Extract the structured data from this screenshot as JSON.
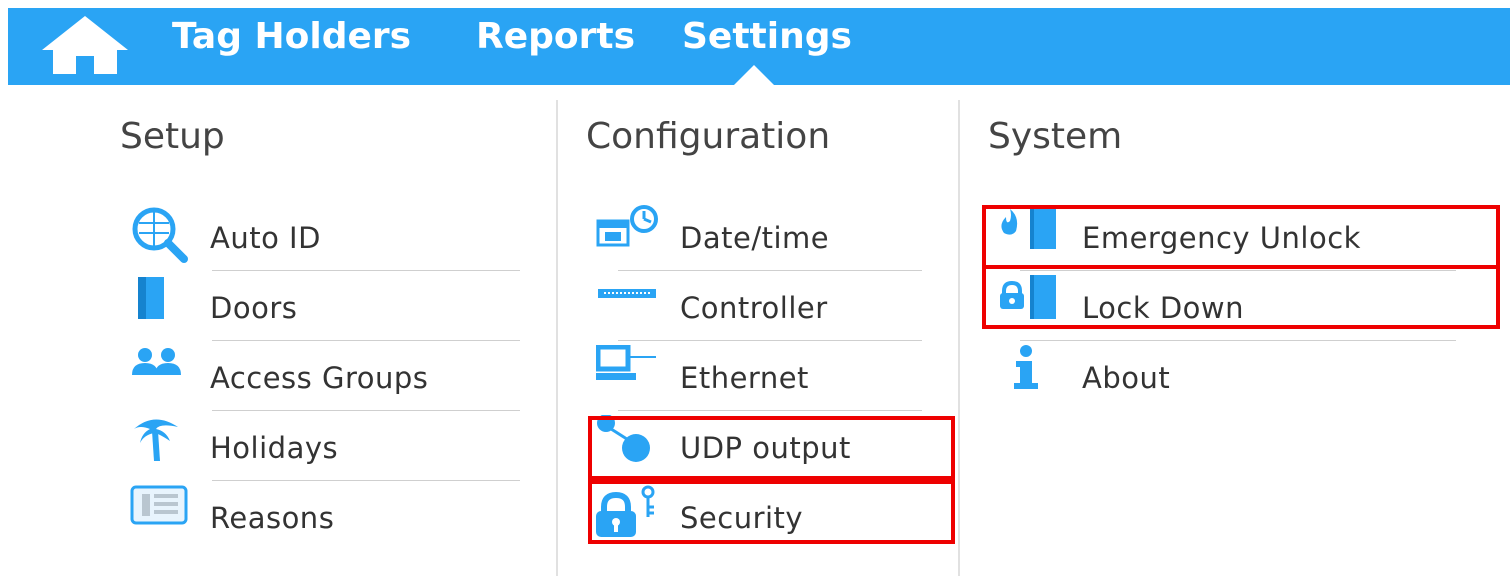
{
  "nav": {
    "tag_holders": "Tag Holders",
    "reports": "Reports",
    "settings": "Settings"
  },
  "colors": {
    "accent": "#2aa4f4",
    "highlight": "#ee0000"
  },
  "setup": {
    "heading": "Setup",
    "items": [
      {
        "label": "Auto ID",
        "icon": "auto-id-icon"
      },
      {
        "label": "Doors",
        "icon": "door-icon"
      },
      {
        "label": "Access Groups",
        "icon": "users-icon"
      },
      {
        "label": "Holidays",
        "icon": "palm-tree-icon"
      },
      {
        "label": "Reasons",
        "icon": "list-icon"
      }
    ]
  },
  "configuration": {
    "heading": "Configuration",
    "items": [
      {
        "label": "Date/time",
        "icon": "calendar-clock-icon"
      },
      {
        "label": "Controller",
        "icon": "controller-icon"
      },
      {
        "label": "Ethernet",
        "icon": "ethernet-icon"
      },
      {
        "label": "UDP output",
        "icon": "udp-icon",
        "highlighted": true
      },
      {
        "label": "Security",
        "icon": "lock-key-icon",
        "highlighted": true
      }
    ]
  },
  "system": {
    "heading": "System",
    "items": [
      {
        "label": "Emergency Unlock",
        "icon": "fire-door-icon",
        "highlighted": true
      },
      {
        "label": "Lock Down",
        "icon": "lock-door-icon",
        "highlighted": true
      },
      {
        "label": "About",
        "icon": "info-icon"
      }
    ]
  }
}
